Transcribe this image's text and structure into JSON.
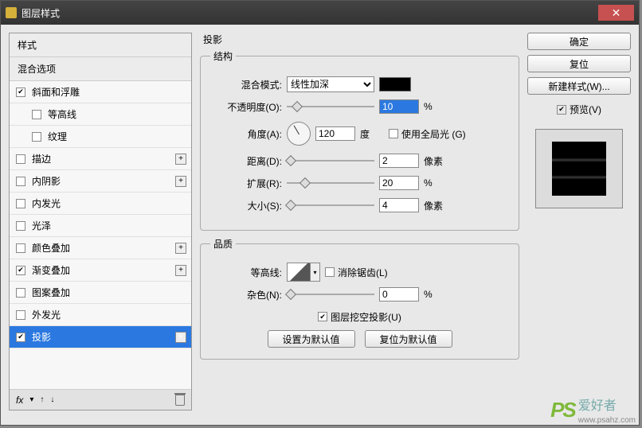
{
  "window": {
    "title": "图层样式"
  },
  "sidebar": {
    "header1": "样式",
    "header2": "混合选项",
    "items": [
      {
        "label": "斜面和浮雕",
        "checked": true,
        "plus": false,
        "indent": false
      },
      {
        "label": "等高线",
        "checked": false,
        "plus": false,
        "indent": true
      },
      {
        "label": "纹理",
        "checked": false,
        "plus": false,
        "indent": true
      },
      {
        "label": "描边",
        "checked": false,
        "plus": true,
        "indent": false
      },
      {
        "label": "内阴影",
        "checked": false,
        "plus": true,
        "indent": false
      },
      {
        "label": "内发光",
        "checked": false,
        "plus": false,
        "indent": false
      },
      {
        "label": "光泽",
        "checked": false,
        "plus": false,
        "indent": false
      },
      {
        "label": "颜色叠加",
        "checked": false,
        "plus": true,
        "indent": false
      },
      {
        "label": "渐变叠加",
        "checked": true,
        "plus": true,
        "indent": false
      },
      {
        "label": "图案叠加",
        "checked": false,
        "plus": false,
        "indent": false
      },
      {
        "label": "外发光",
        "checked": false,
        "plus": false,
        "indent": false
      },
      {
        "label": "投影",
        "checked": true,
        "plus": true,
        "indent": false,
        "selected": true
      }
    ],
    "footer_fx": "fx"
  },
  "panel": {
    "title": "投影",
    "structure": {
      "legend": "结构",
      "blend_label": "混合模式:",
      "blend_value": "线性加深",
      "opacity_label": "不透明度(O):",
      "opacity_value": "10",
      "opacity_unit": "%",
      "angle_label": "角度(A):",
      "angle_value": "120",
      "angle_unit": "度",
      "global_light": "使用全局光 (G)",
      "distance_label": "距离(D):",
      "distance_value": "2",
      "distance_unit": "像素",
      "spread_label": "扩展(R):",
      "spread_value": "20",
      "spread_unit": "%",
      "size_label": "大小(S):",
      "size_value": "4",
      "size_unit": "像素"
    },
    "quality": {
      "legend": "品质",
      "contour_label": "等高线:",
      "antialias": "消除锯齿(L)",
      "noise_label": "杂色(N):",
      "noise_value": "0",
      "noise_unit": "%"
    },
    "knockout": "图层挖空投影(U)",
    "btn_default": "设置为默认值",
    "btn_reset": "复位为默认值"
  },
  "right": {
    "ok": "确定",
    "cancel": "复位",
    "new_style": "新建样式(W)...",
    "preview": "预览(V)"
  },
  "watermark": {
    "ps": "PS",
    "txt": "爱好者",
    "url": "www.psahz.com"
  }
}
